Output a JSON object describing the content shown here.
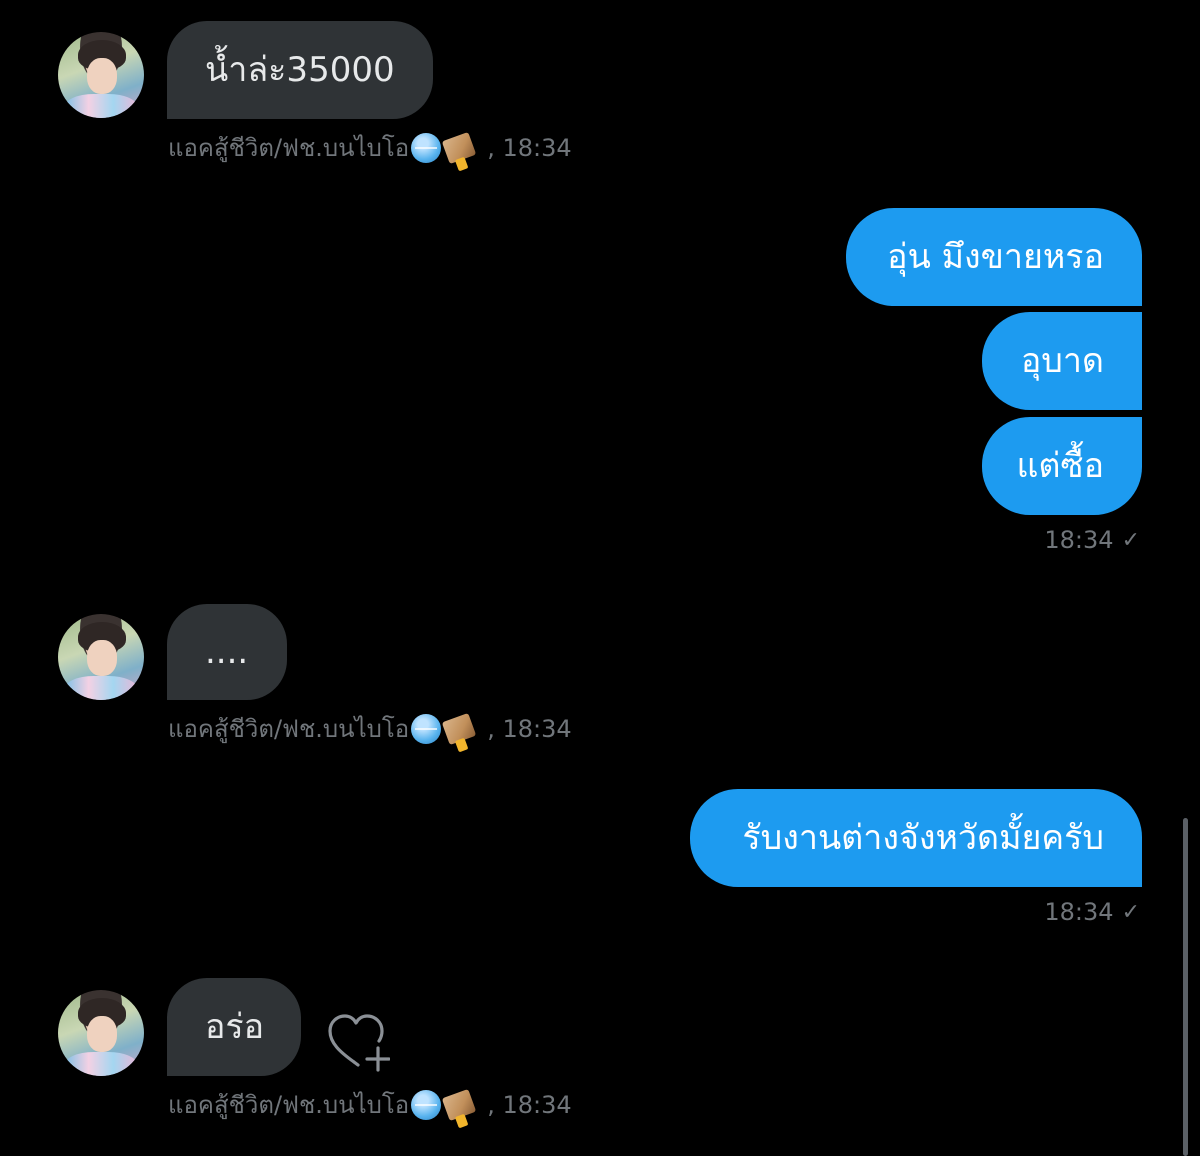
{
  "conversation": {
    "sender_name": "แอคสู้ชีวิต/ฟช.บนไบโอ",
    "sender_badges": [
      "globe-emoji",
      "package-emoji"
    ],
    "messages": [
      {
        "direction": "in",
        "text": "น้ำล่ะ35000",
        "time": ", 18:34"
      },
      {
        "direction": "out",
        "text": "อุ่น มึงขายหรอ"
      },
      {
        "direction": "out",
        "text": "อุบาด"
      },
      {
        "direction": "out",
        "text": "แต่ซื้อ",
        "time": "18:34",
        "status": "✓"
      },
      {
        "direction": "in",
        "text": "....",
        "time": ", 18:34"
      },
      {
        "direction": "out",
        "text": "รับงานต่างจังหวัดมั้ยครับ",
        "time": "18:34",
        "status": "✓"
      },
      {
        "direction": "in",
        "text": "อร่อ",
        "time": ", 18:34",
        "reaction_icon": "heart-plus-icon"
      }
    ]
  },
  "colors": {
    "background": "#000000",
    "incoming_bubble": "#2f3336",
    "outgoing_bubble": "#1d9bf0",
    "meta_text": "#71767b"
  }
}
